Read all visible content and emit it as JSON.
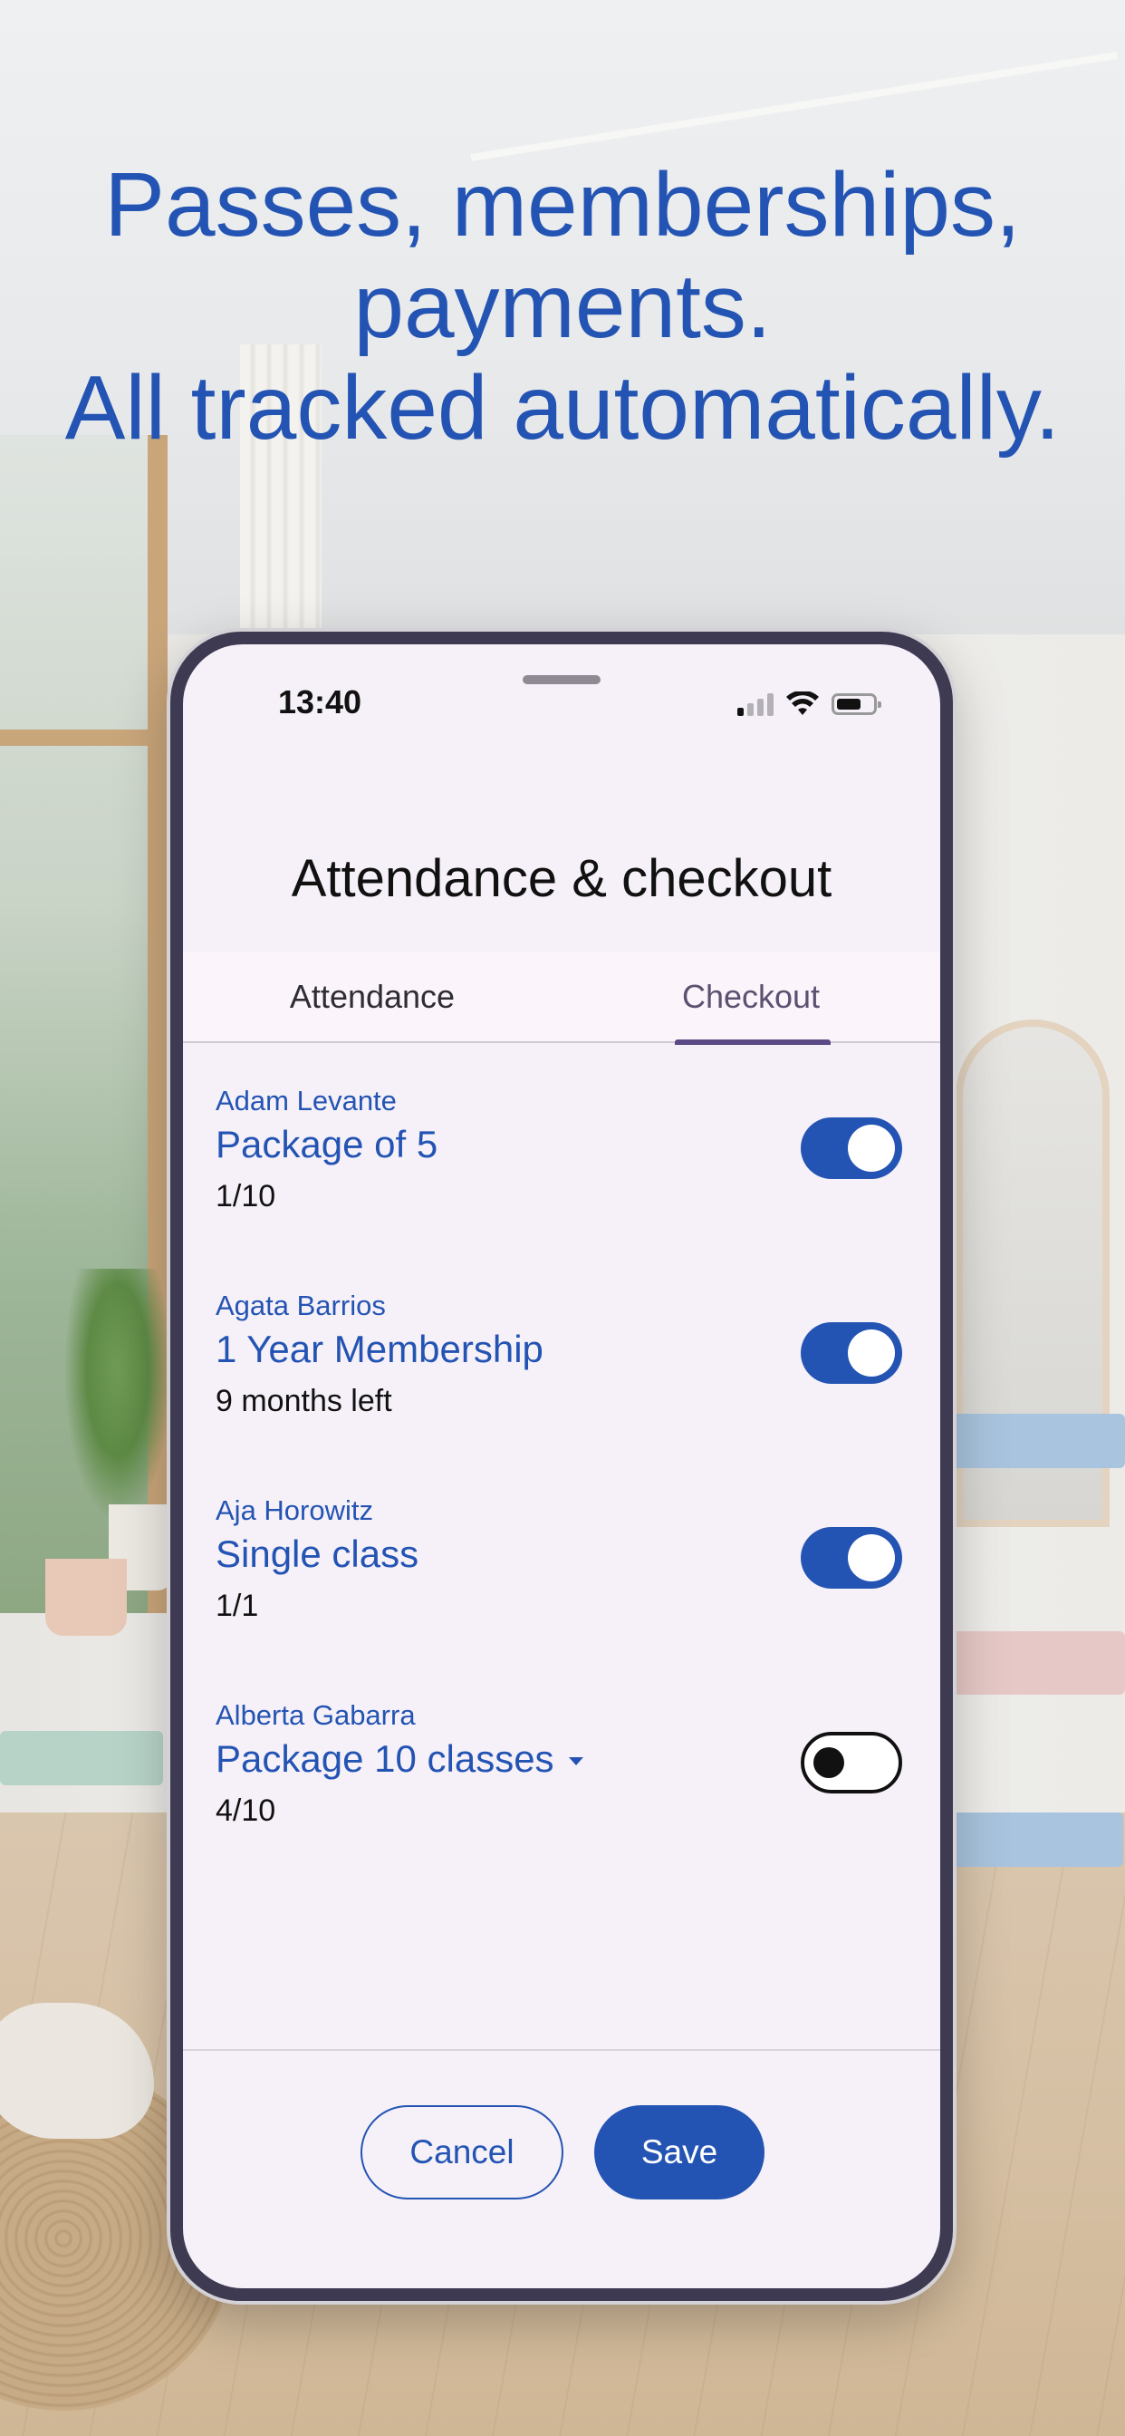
{
  "headline": {
    "line1": "Passes, memberships,",
    "line2": "payments.",
    "line3": "All tracked automatically."
  },
  "status_bar": {
    "time": "13:40"
  },
  "sheet": {
    "title": "Attendance & checkout",
    "tabs": [
      {
        "label": "Attendance",
        "selected": false
      },
      {
        "label": "Checkout",
        "selected": true
      }
    ],
    "clients": [
      {
        "name": "Adam Levante",
        "pass": "Package of 5",
        "usage": "1/10",
        "checked_out": true,
        "has_dropdown": false
      },
      {
        "name": "Agata Barrios",
        "pass": "1 Year Membership",
        "usage": "9 months left",
        "checked_out": true,
        "has_dropdown": false
      },
      {
        "name": "Aja Horowitz",
        "pass": "Single class",
        "usage": "1/1",
        "checked_out": true,
        "has_dropdown": false
      },
      {
        "name": "Alberta Gabarra",
        "pass": "Package 10 classes",
        "usage": "4/10",
        "checked_out": false,
        "has_dropdown": true
      }
    ],
    "actions": {
      "cancel_label": "Cancel",
      "save_label": "Save"
    }
  },
  "colors": {
    "brand_blue": "#2454b3",
    "tab_indicator": "#5c4a84",
    "sheet_background": "#f6f1f8"
  },
  "icons": [
    "signal-icon",
    "wifi-icon",
    "battery-icon",
    "chevron-down-icon"
  ]
}
